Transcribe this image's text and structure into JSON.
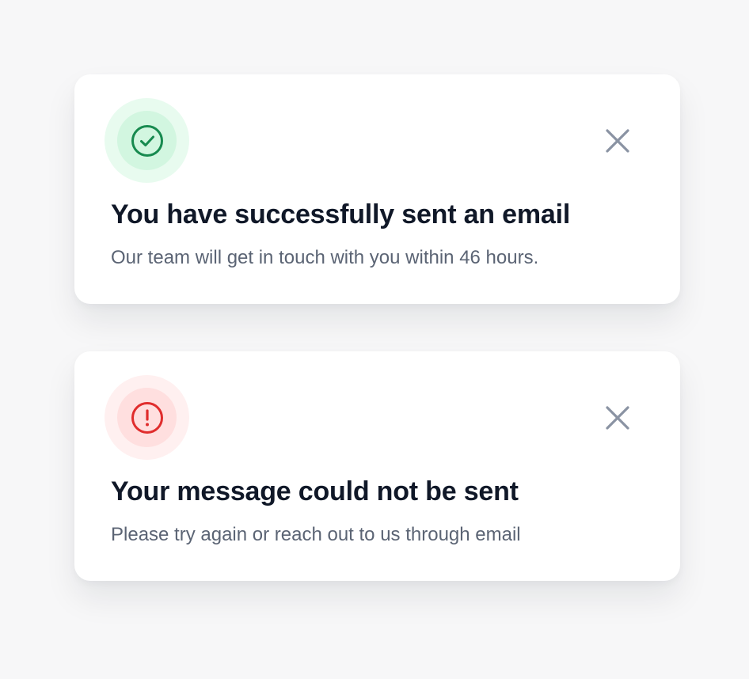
{
  "colors": {
    "background": "#f7f7f8",
    "card": "#ffffff",
    "title_text": "#101828",
    "body_text": "#5b6474",
    "success_accent": "#178a4f",
    "error_accent": "#e02d2d",
    "close_icon": "#8a93a3"
  },
  "toasts": [
    {
      "type": "success",
      "icon": "check-circle-icon",
      "title": "You have successfully sent an email",
      "message": "Our team will get in touch with you within 46 hours.",
      "close_icon": "close-icon"
    },
    {
      "type": "error",
      "icon": "alert-circle-icon",
      "title": "Your message could not be sent",
      "message": "Please try again or reach out to us through email",
      "close_icon": "close-icon"
    }
  ]
}
